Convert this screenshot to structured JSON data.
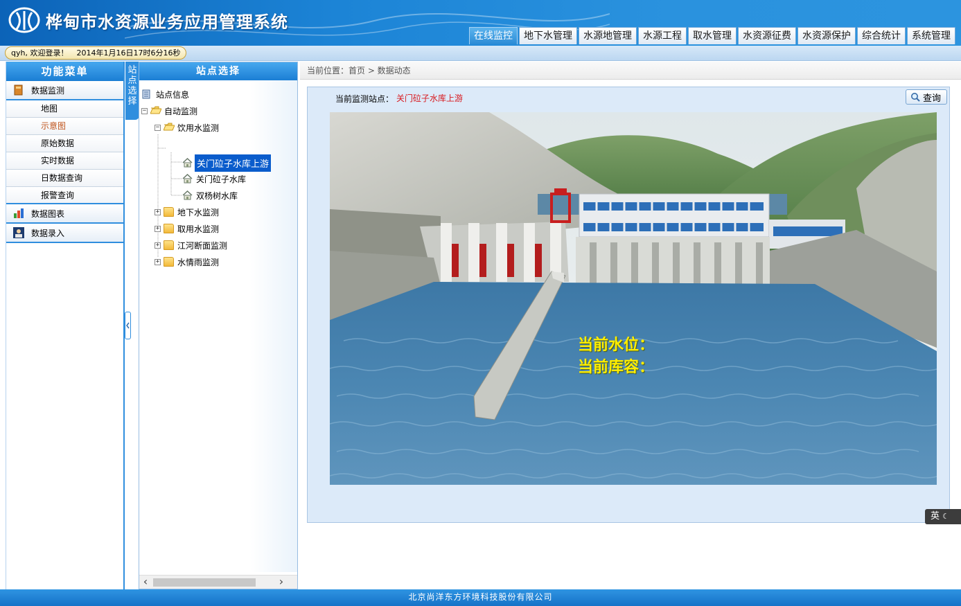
{
  "header": {
    "title": "桦甸市水资源业务应用管理系统",
    "tabs": [
      {
        "label": "在线监控",
        "active": true
      },
      {
        "label": "地下水管理"
      },
      {
        "label": "水源地管理"
      },
      {
        "label": "水源工程"
      },
      {
        "label": "取水管理"
      },
      {
        "label": "水资源征费"
      },
      {
        "label": "水资源保护"
      },
      {
        "label": "综合统计"
      },
      {
        "label": "系统管理"
      }
    ]
  },
  "status": {
    "welcome": "qyh, 欢迎登录！",
    "datetime": "2014年1月16日17时6分16秒"
  },
  "func_menu": {
    "title": "功能菜单",
    "groups": [
      {
        "label": "数据监测",
        "icon": "book-icon"
      },
      {
        "label": "数据图表",
        "icon": "chart-icon"
      },
      {
        "label": "数据录入",
        "icon": "user-entry-icon"
      }
    ],
    "items": [
      {
        "label": "地图"
      },
      {
        "label": "示意图",
        "active": true
      },
      {
        "label": "原始数据"
      },
      {
        "label": "实时数据"
      },
      {
        "label": "日数据查询"
      },
      {
        "label": "报警查询"
      }
    ]
  },
  "vertical_tab": {
    "label": "站点选择"
  },
  "site_panel": {
    "title": "站点选择",
    "tree": {
      "root": "站点信息",
      "auto": "自动监测",
      "drinking": "饮用水监测",
      "sites": [
        "关门砬子水库上游",
        "关门砬子水库",
        "双杨树水库"
      ],
      "groundwater": "地下水监测",
      "intake": "取用水监测",
      "river": "江河断面监测",
      "rain": "水情雨监测"
    }
  },
  "breadcrumb": "当前位置：首页 > 数据动态",
  "main": {
    "station_label": "当前监测站点：",
    "station_name": "关门砬子水库上游",
    "query_label": "查询",
    "water_level_label": "当前水位：",
    "capacity_label": "当前库容："
  },
  "ime_label": "英",
  "footer": "北京尚洋东方环境科技股份有限公司",
  "colors": {
    "primary_blue": "#1b7ed4",
    "station_red": "#d8191e",
    "readout_yellow": "#ffee00"
  }
}
